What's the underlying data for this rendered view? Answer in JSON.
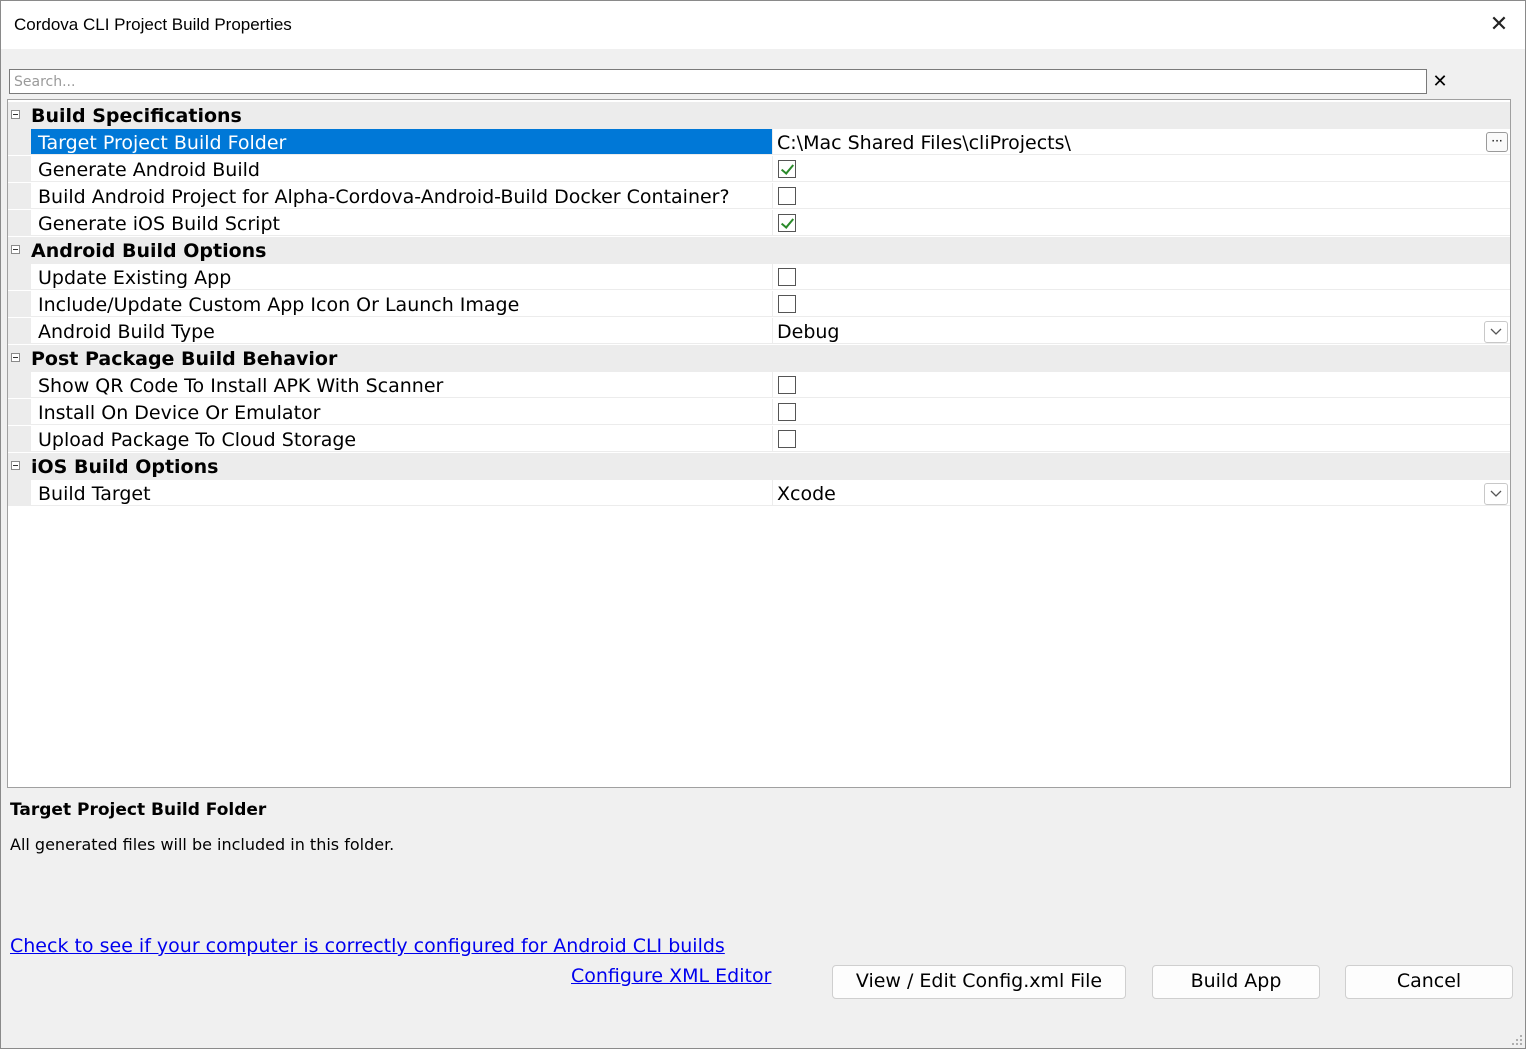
{
  "window": {
    "title": "Cordova CLI Project Build Properties"
  },
  "search": {
    "placeholder": "Search..."
  },
  "property_grid": {
    "categories": [
      {
        "label": "Build Specifications",
        "properties": [
          {
            "name": "Target Project Build Folder",
            "type": "path",
            "value": "C:\\Mac Shared Files\\cliProjects\\",
            "selected": true
          },
          {
            "name": "Generate Android Build",
            "type": "checkbox",
            "checked": true
          },
          {
            "name": "Build Android Project for Alpha-Cordova-Android-Build Docker Container?",
            "type": "checkbox",
            "checked": false
          },
          {
            "name": "Generate iOS Build Script",
            "type": "checkbox",
            "checked": true
          }
        ]
      },
      {
        "label": "Android Build Options",
        "properties": [
          {
            "name": "Update Existing App",
            "type": "checkbox",
            "checked": false
          },
          {
            "name": "Include/Update Custom App Icon Or Launch Image",
            "type": "checkbox",
            "checked": false
          },
          {
            "name": "Android Build Type",
            "type": "dropdown",
            "value": "Debug"
          }
        ]
      },
      {
        "label": "Post Package Build Behavior",
        "properties": [
          {
            "name": "Show QR Code To Install APK With Scanner",
            "type": "checkbox",
            "checked": false
          },
          {
            "name": "Install On Device Or Emulator",
            "type": "checkbox",
            "checked": false
          },
          {
            "name": "Upload Package To Cloud Storage",
            "type": "checkbox",
            "checked": false
          }
        ]
      },
      {
        "label": "iOS Build Options",
        "properties": [
          {
            "name": "Build Target",
            "type": "dropdown",
            "value": "Xcode"
          }
        ]
      }
    ]
  },
  "description": {
    "title": "Target Project Build Folder",
    "text": "All generated files will be included in this folder."
  },
  "links": {
    "check_android": "Check to see if your computer is correctly configured for Android CLI builds",
    "configure_xml": "Configure XML Editor"
  },
  "buttons": {
    "view_edit": "View / Edit Config.xml File",
    "build_app": "Build App",
    "cancel": "Cancel"
  },
  "icons": {
    "close": "close-icon",
    "search_clear": "clear-icon",
    "collapse": "collapse-icon",
    "dropdown": "chevron-down-icon",
    "ellipsis": "ellipsis-icon"
  },
  "colors": {
    "selection": "#0078d7",
    "link": "#0000ee",
    "category_bg": "#ececec"
  }
}
